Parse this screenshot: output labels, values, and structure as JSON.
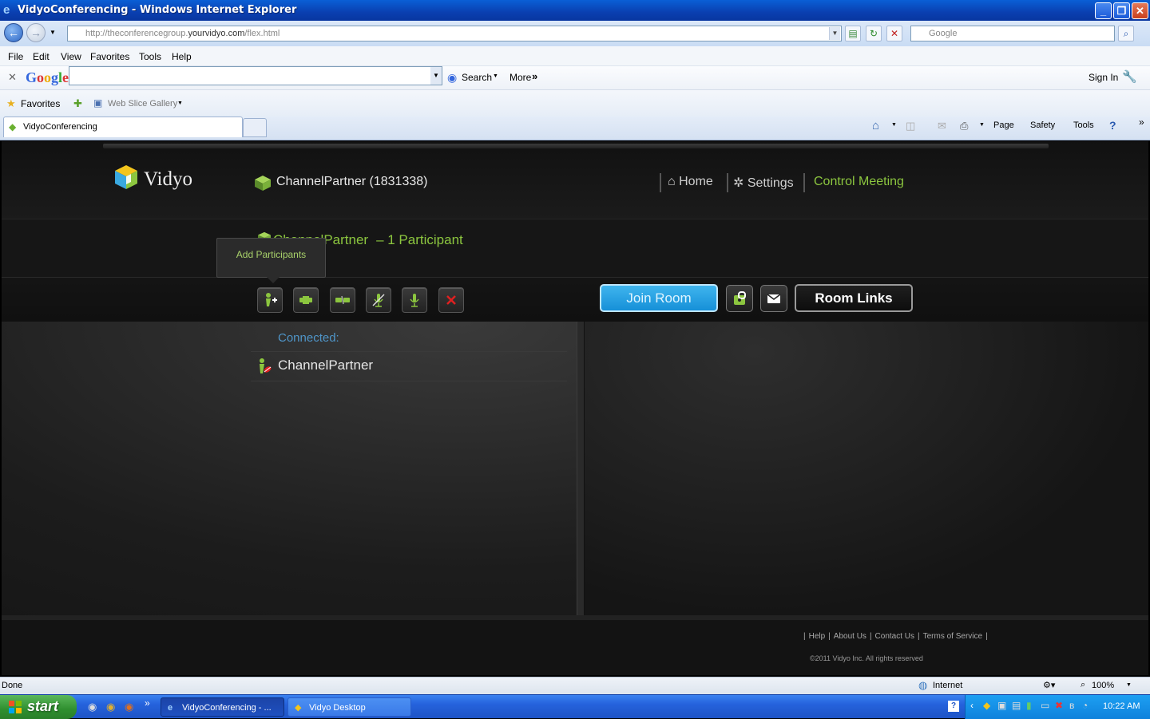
{
  "window": {
    "title": "VidyoConferencing - Windows Internet Explorer"
  },
  "addressbar": {
    "url_prefix": "http://theconferencegroup.",
    "url_domain": "yourvidyo.com",
    "url_suffix": "/flex.html",
    "search_placeholder": "Google"
  },
  "menubar": {
    "items": [
      "File",
      "Edit",
      "View",
      "Favorites",
      "Tools",
      "Help"
    ]
  },
  "googlebar": {
    "logo": "Google",
    "search_label": "Search",
    "more_label": "More",
    "sign_in": "Sign In"
  },
  "favorites": {
    "label": "Favorites",
    "web_slice": "Web Slice Gallery"
  },
  "tabs": [
    {
      "label": "VidyoConferencing"
    }
  ],
  "commandbar": {
    "page": "Page",
    "safety": "Safety",
    "tools": "Tools"
  },
  "app": {
    "brand": "Vidyo",
    "user": "ChannelPartner (1831338)",
    "nav": {
      "home": "Home",
      "settings": "Settings",
      "control_meeting": "Control Meeting"
    },
    "room": {
      "name": "ChannelPartner",
      "participant_count": "– 1 Participant"
    },
    "tooltip": "Add Participants",
    "buttons": {
      "join_room": "Join Room",
      "room_links": "Room Links"
    },
    "connected_label": "Connected:",
    "participants": [
      {
        "name": "ChannelPartner"
      }
    ],
    "footer": {
      "links": [
        "Help",
        "About Us",
        "Contact Us",
        "Terms of Service"
      ],
      "copyright": "©2011 Vidyo Inc. All rights reserved"
    }
  },
  "statusbar": {
    "status": "Done",
    "zone": "Internet",
    "zoom": "100%"
  },
  "taskbar": {
    "start": "start",
    "tasks": [
      "VidyoConferencing - ...",
      "Vidyo Desktop"
    ],
    "clock": "10:22 AM"
  },
  "colors": {
    "accent_green": "#8cc63f",
    "join_blue": "#1e9be0",
    "connected_blue": "#4f95c8"
  }
}
